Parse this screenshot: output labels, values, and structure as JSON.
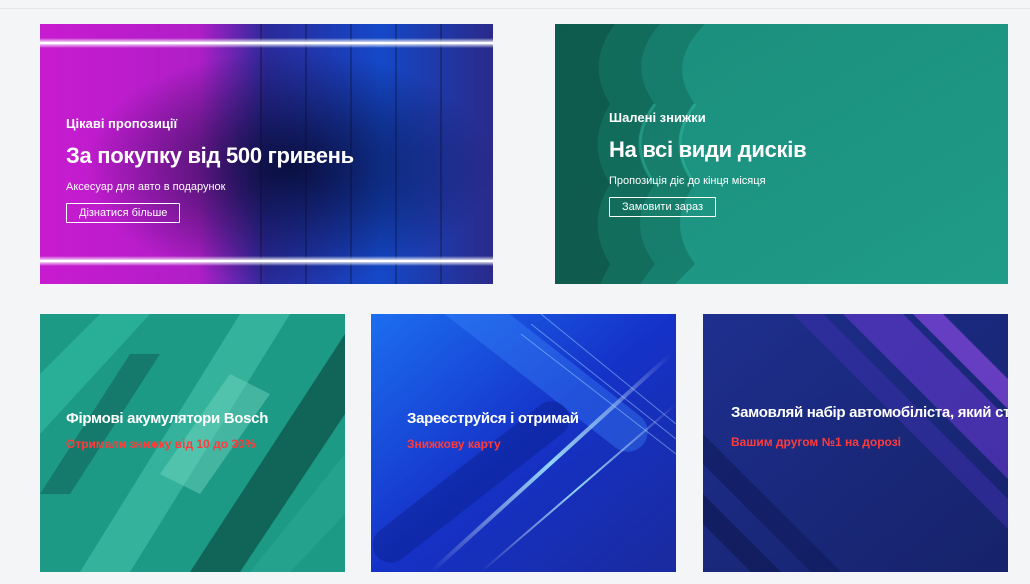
{
  "banners": [
    {
      "eyebrow": "Цікаві пропозиції",
      "headline": "За покупку від 500 гривень",
      "subtitle": "Аксесуар для авто в подарунок",
      "cta": "Дізнатися більше"
    },
    {
      "eyebrow": "Шалені знижки",
      "headline": "На всі види дисків",
      "subtitle": "Пропозиція діє до кінця місяця",
      "cta": "Замовити зараз"
    },
    {
      "title": "Фірмові акумулятори Bosch",
      "subtitle": "Отримали знижку від 10 до 30%"
    },
    {
      "title": "Зареєструйся і отримай",
      "subtitle": "Знижкову карту"
    },
    {
      "title": "Замовляй набір автомобіліста, який стане",
      "subtitle": "Вашим другом №1 на дорозі"
    }
  ],
  "colors": {
    "accent_red": "#ff3b3b",
    "teal": "#1f9a86",
    "blue": "#1c3fd8",
    "navy": "#1a2a7a",
    "magenta": "#d01bd6"
  }
}
